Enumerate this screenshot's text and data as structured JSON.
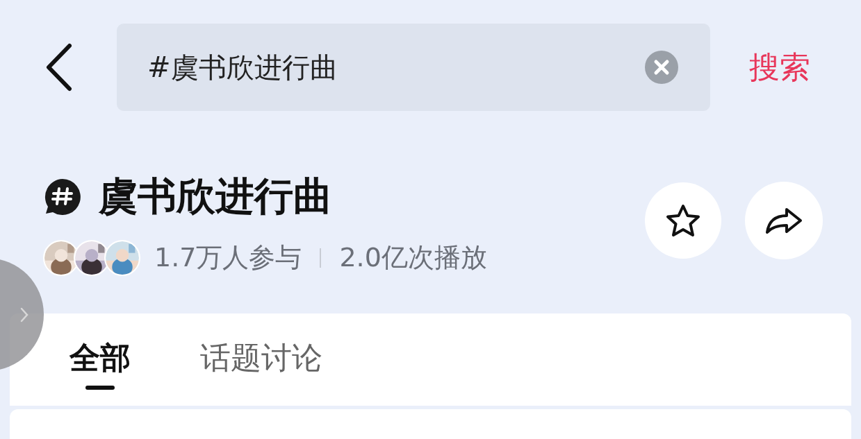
{
  "search": {
    "value": "#虞书欣进行曲",
    "action": "搜索"
  },
  "topic": {
    "title": "虞书欣进行曲",
    "avatars": [
      {
        "kind": "picture"
      },
      {
        "kind": "picture"
      },
      {
        "kind": "picture"
      }
    ],
    "stats": [
      "1.7万人参与",
      "2.0亿次播放"
    ]
  },
  "tabs": [
    {
      "label": "全部",
      "selected": true
    },
    {
      "label": "话题讨论",
      "selected": false
    }
  ]
}
